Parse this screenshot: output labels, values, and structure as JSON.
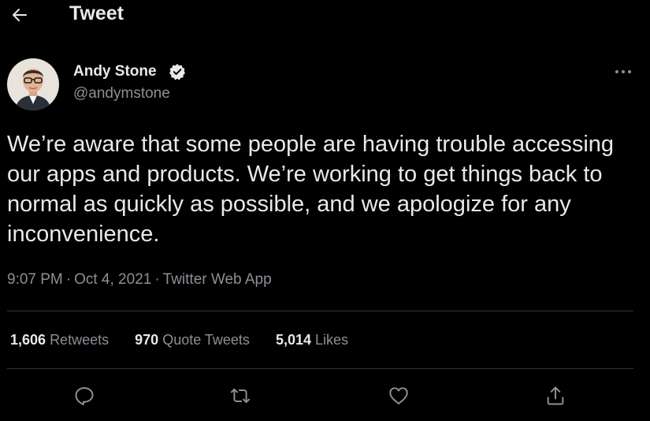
{
  "header": {
    "back_icon": "arrow-left-icon",
    "title": "Tweet"
  },
  "tweet": {
    "author": {
      "name": "Andy Stone",
      "handle": "@andymstone",
      "verified": true,
      "verified_icon": "verified-badge-icon"
    },
    "more_icon": "more-horizontal-icon",
    "text": "We’re aware that some people are having trouble accessing our apps and products. We’re working to get things back to normal as quickly as possible, and we apologize for any inconvenience.",
    "time": "9:07 PM",
    "separator": "·",
    "date": "Oct 4, 2021",
    "source": "Twitter Web App"
  },
  "stats": {
    "retweets": {
      "count": "1,606",
      "label": "Retweets"
    },
    "quote_tweets": {
      "count": "970",
      "label": "Quote Tweets"
    },
    "likes": {
      "count": "5,014",
      "label": "Likes"
    }
  },
  "actions": [
    {
      "icon": "reply-icon"
    },
    {
      "icon": "retweet-icon"
    },
    {
      "icon": "like-icon"
    },
    {
      "icon": "share-icon"
    }
  ],
  "colors": {
    "background": "#000000",
    "text": "#e7e9ea",
    "secondary": "#8b9096",
    "divider": "#2f3336"
  }
}
